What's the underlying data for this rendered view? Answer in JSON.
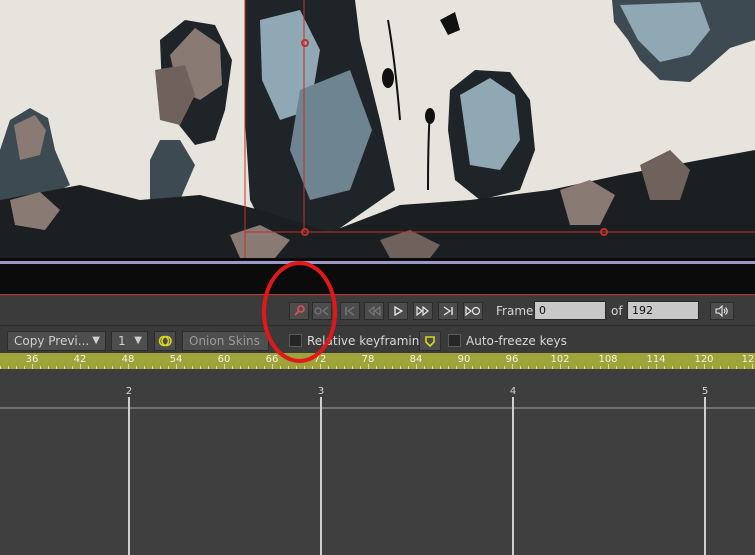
{
  "colors": {
    "canvas_bg": "#e6e4dc",
    "rock_dark": "#3d4a52",
    "rock_blue": "#90a8b3",
    "rock_brown": "#8a7a74",
    "ruler_green": "#9ea33a",
    "highlight_red": "#e3171a",
    "bone_red": "#c0302b",
    "accent_yellow": "#d8d81e"
  },
  "transport": {
    "icons": [
      "keyframe-key-icon",
      "prev-key-icon",
      "go-to-start-icon",
      "step-back-icon",
      "play-icon",
      "step-forward-icon",
      "go-to-end-icon",
      "loop-icon",
      "audio-icon"
    ],
    "frame_label": "Frame",
    "frame_value": "0",
    "of_label": "of",
    "total_frames": "192"
  },
  "toolbar": {
    "copy_dropdown": "Copy Previ...",
    "count_dropdown": "1",
    "onion_skins_label": "Onion Skins",
    "relative_keyframing_label": "Relative keyframing",
    "relative_keyframing_checked": false,
    "auto_freeze_label": "Auto-freeze keys",
    "auto_freeze_checked": false
  },
  "ruler": {
    "labels": [
      "36",
      "42",
      "48",
      "54",
      "60",
      "66",
      "72",
      "78",
      "84",
      "90",
      "96",
      "102",
      "108",
      "114",
      "120",
      "12"
    ]
  },
  "timeline": {
    "markers": [
      "2",
      "3",
      "4",
      "5"
    ]
  }
}
